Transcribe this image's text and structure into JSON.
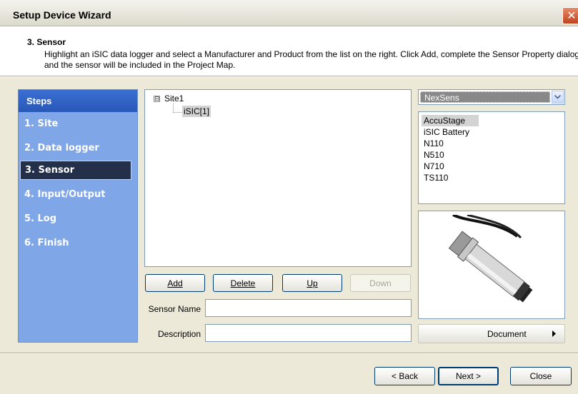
{
  "window": {
    "title": "Setup Device Wizard",
    "close_glyph": "✕"
  },
  "header": {
    "step_title": "3. Sensor",
    "description": "Highlight an iSIC data logger and select a Manufacturer and Product from the list on the right. Click Add, complete the Sensor Property dialog and the sensor will be included in the Project Map."
  },
  "sidebar": {
    "title": "Steps",
    "items": [
      {
        "label": "1. Site"
      },
      {
        "label": "2. Data logger"
      },
      {
        "label": "3. Sensor",
        "active": true
      },
      {
        "label": "4. Input/Output"
      },
      {
        "label": "5. Log"
      },
      {
        "label": "6. Finish"
      }
    ]
  },
  "tree": {
    "root": {
      "label": "Site1",
      "expander": "⊟"
    },
    "child": {
      "label": "iSIC[1]"
    }
  },
  "buttons": {
    "add": "Add",
    "delete": "Delete",
    "up": "Up",
    "down": "Down",
    "back": "< Back",
    "next": "Next >",
    "close": "Close",
    "document": "Document"
  },
  "fields": {
    "sensor_name_label": "Sensor Name",
    "sensor_name_value": "",
    "description_label": "Description",
    "description_value": ""
  },
  "manufacturer": {
    "selected": "NexSens"
  },
  "products": {
    "items": [
      "AccuStage",
      "iSIC Battery",
      "N110",
      "N510",
      "N710",
      "TS110"
    ],
    "selected_index": 0
  },
  "colors": {
    "sidebar_bg": "#7fa6e6",
    "sidebar_header": "#2858b8",
    "active_step": "#24304a",
    "dialog_bg": "#ece9d8"
  }
}
